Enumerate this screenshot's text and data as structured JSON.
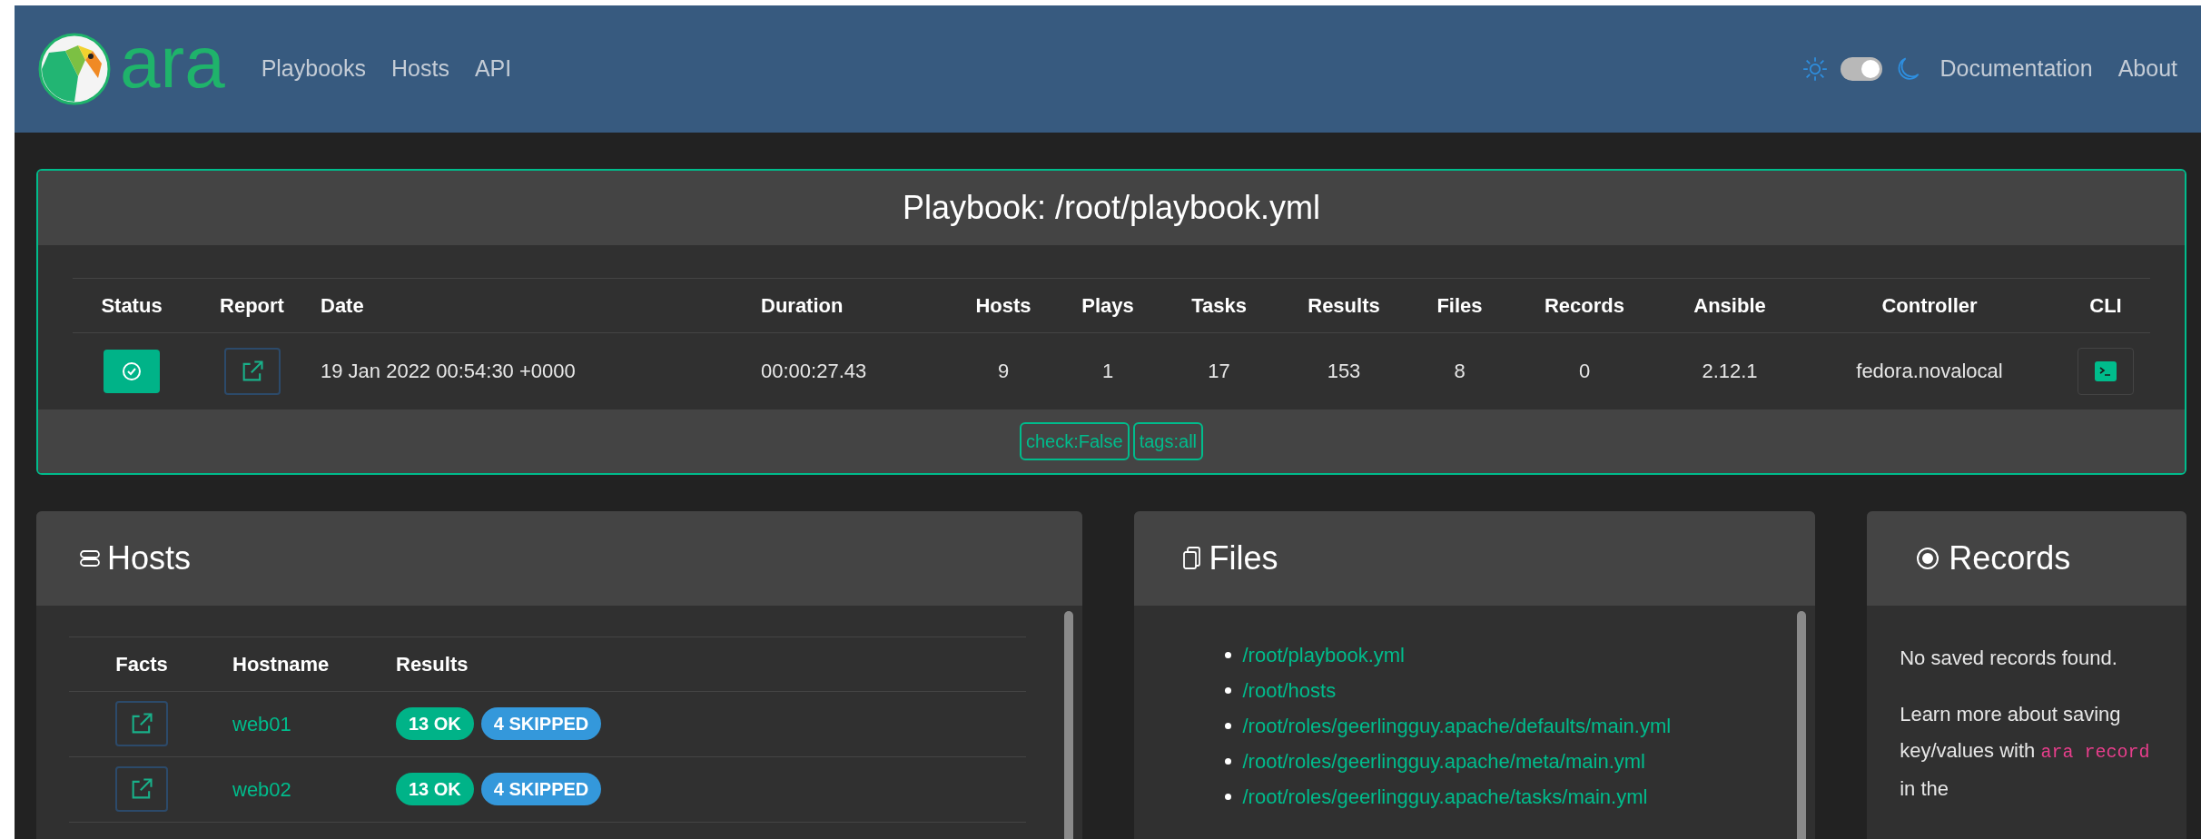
{
  "navbar": {
    "logo_text": "ara",
    "links": [
      "Playbooks",
      "Hosts",
      "API"
    ],
    "theme_toggle": {
      "on": true
    },
    "right_links": [
      "Documentation",
      "About"
    ]
  },
  "playbook": {
    "title": "Playbook: /root/playbook.yml",
    "columns": [
      "Status",
      "Report",
      "Date",
      "Duration",
      "Hosts",
      "Plays",
      "Tasks",
      "Results",
      "Files",
      "Records",
      "Ansible",
      "Controller",
      "CLI"
    ],
    "row": {
      "succeeded": true,
      "date": "19 Jan 2022 00:54:30 +0000",
      "duration": "00:00:27.43",
      "hosts": "9",
      "plays": "1",
      "tasks": "17",
      "results": "153",
      "files": "8",
      "records": "0",
      "ansible": "2.12.1",
      "controller": "fedora.novalocal"
    },
    "tags": [
      "check:False",
      "tags:all"
    ]
  },
  "hosts": {
    "title": "Hosts",
    "columns": [
      "Facts",
      "Hostname",
      "Results"
    ],
    "rows": [
      {
        "hostname": "web01",
        "results": [
          {
            "label": "13 OK",
            "kind": "ok"
          },
          {
            "label": "4 SKIPPED",
            "kind": "skipped"
          }
        ]
      },
      {
        "hostname": "web02",
        "results": [
          {
            "label": "13 OK",
            "kind": "ok"
          },
          {
            "label": "4 SKIPPED",
            "kind": "skipped"
          }
        ]
      }
    ]
  },
  "files": {
    "title": "Files",
    "items": [
      "/root/playbook.yml",
      "/root/hosts",
      "/root/roles/geerlingguy.apache/defaults/main.yml",
      "/root/roles/geerlingguy.apache/meta/main.yml",
      "/root/roles/geerlingguy.apache/tasks/main.yml"
    ]
  },
  "records": {
    "title": "Records",
    "empty_text": "No saved records found.",
    "help": {
      "before": "Learn more about saving key/values with",
      "code": "ara record",
      "after": "in the"
    }
  }
}
